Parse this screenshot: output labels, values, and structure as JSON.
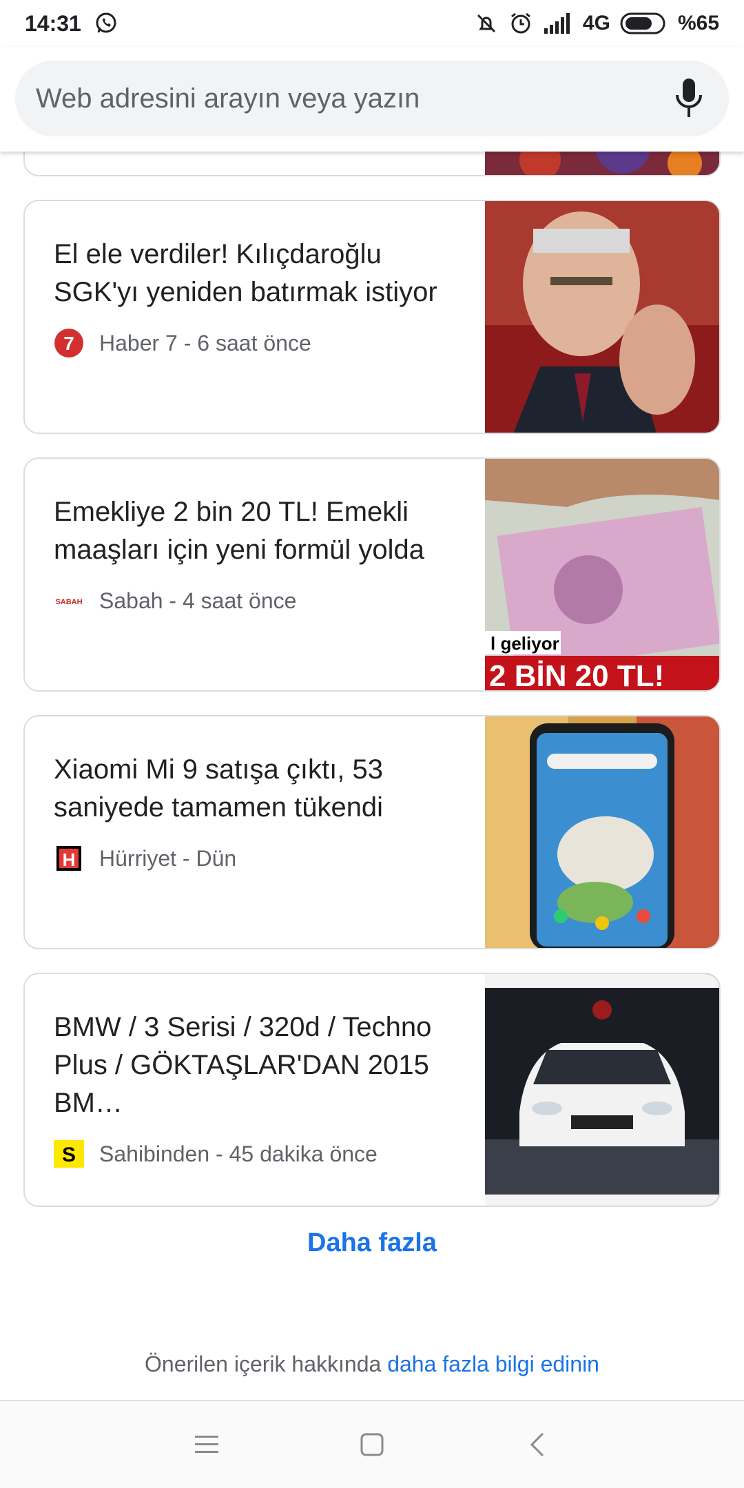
{
  "status_bar": {
    "time": "14:31",
    "network": "4G",
    "battery": "%65",
    "icons": [
      "whatsapp-icon",
      "notifications-muted-icon",
      "alarm-icon",
      "signal-icon",
      "battery-icon"
    ]
  },
  "search": {
    "placeholder": "Web adresini arayın veya yazın",
    "icon": "mic-icon"
  },
  "cards": [
    {
      "title": "El ele verdiler! Kılıçdaroğlu SGK'yı yeniden batırmak istiyor",
      "source": "Haber 7 - 6 saat önce",
      "logo_text": "7",
      "logo_color": "#d32f2f"
    },
    {
      "title": "Emekliye 2 bin 20 TL! Emekli maaşları için yeni formül yolda",
      "source": "Sabah - 4 saat önce",
      "logo_text": "SABAH",
      "logo_color": "#c62828",
      "image_caption_1": "l geliyor",
      "image_caption_2": "2 BİN 20 TL!"
    },
    {
      "title": "Xiaomi Mi 9 satışa çıktı, 53 saniyede tamamen tükendi",
      "source": "Hürriyet - Dün",
      "logo_text": "H",
      "logo_color": "#e53935"
    },
    {
      "title": "BMW / 3 Serisi / 320d / Techno Plus / GÖKTAŞLAR'DAN 2015 BM…",
      "source": "Sahibinden - 45 dakika önce",
      "logo_text": "S",
      "logo_color": "#ffe800"
    }
  ],
  "more_label": "Daha fazla",
  "footer": {
    "text": "Önerilen içerik hakkında",
    "link": "daha fazla bilgi edinin"
  },
  "nav": [
    "menu-icon",
    "home-icon",
    "back-icon"
  ],
  "colors": {
    "accent": "#1a73e8",
    "search_bg": "#f1f3f4",
    "card_border": "#dadce0"
  }
}
